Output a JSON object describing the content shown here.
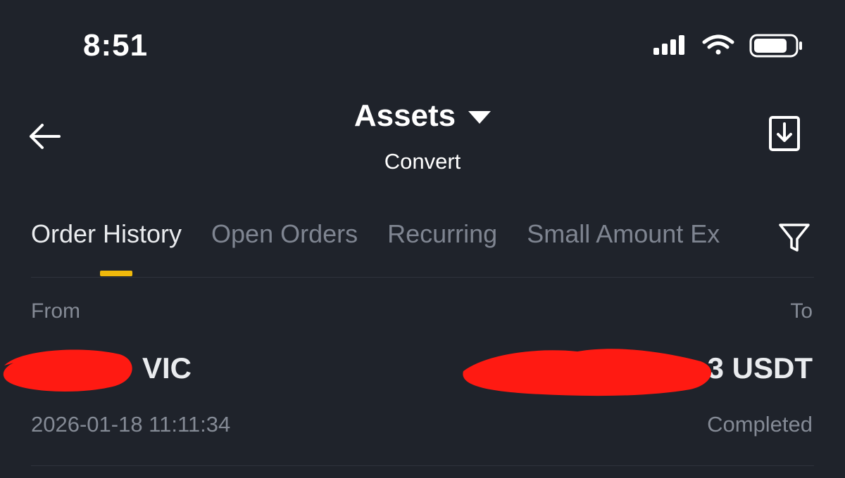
{
  "status_bar": {
    "time": "8:51"
  },
  "header": {
    "title": "Assets",
    "subtitle": "Convert"
  },
  "tabs": [
    {
      "label": "Order History",
      "active": true
    },
    {
      "label": "Open Orders",
      "active": false
    },
    {
      "label": "Recurring",
      "active": false
    },
    {
      "label": "Small Amount Ex",
      "active": false
    }
  ],
  "columns": {
    "from": "From",
    "to": "To"
  },
  "orders": [
    {
      "from_amount": "VIC",
      "to_amount": "3 USDT",
      "time": "2026-01-18 11:11:34",
      "status": "Completed"
    }
  ],
  "colors": {
    "background": "#1f232b",
    "accent": "#f0b90b",
    "muted_text": "#848a95",
    "redaction": "#ff1a12"
  },
  "icons": {
    "back": "arrow-left-icon",
    "dropdown": "caret-down-icon",
    "download": "download-icon",
    "filter": "filter-icon"
  }
}
